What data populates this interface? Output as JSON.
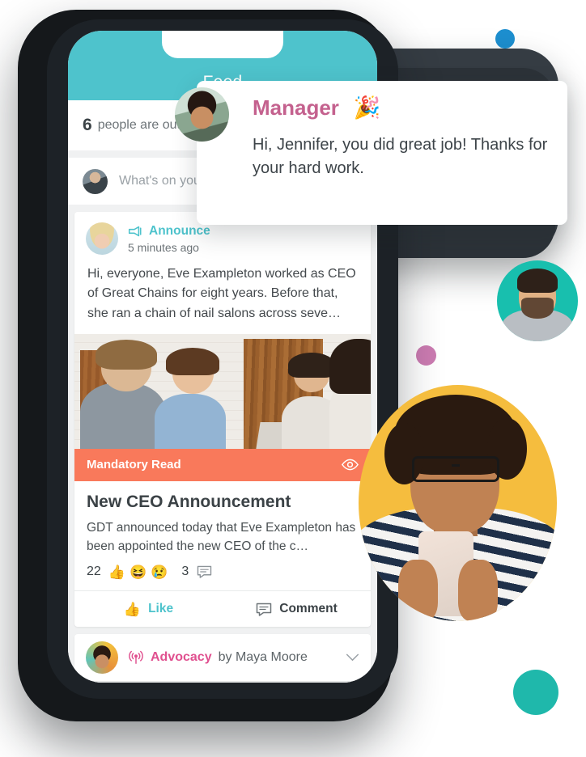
{
  "app": {
    "header": {
      "title": "Feed"
    }
  },
  "out_of_office": {
    "count": "6",
    "text": "people are out"
  },
  "composer": {
    "placeholder": "What's on your m",
    "avatar_name": "user-avatar"
  },
  "post": {
    "type": "Announce",
    "type_icon": "megaphone-icon",
    "timestamp": "5 minutes ago",
    "body": "Hi, everyone, Eve Exampleton worked as CEO of Great Chains for eight years. Before that, she ran a chain of nail salons across seve…",
    "article": {
      "banner_label": "Mandatory Read",
      "banner_icon": "eye-icon",
      "title": "New CEO Announcement",
      "description": "GDT announced today that Eve Exampleton has been appointed the new CEO of the c…",
      "reaction_count": "22",
      "reactions": [
        "👍",
        "😆",
        "😢"
      ],
      "comment_count": "3",
      "comment_icon": "comment-icon"
    },
    "actions": {
      "like_label": "Like",
      "like_icon": "thumbs-up-icon",
      "comment_label": "Comment",
      "comment_icon": "comment-icon"
    }
  },
  "advocacy": {
    "type": "Advocacy",
    "type_icon": "broadcast-icon",
    "by": "by Maya Moore",
    "chevron_icon": "chevron-down-icon"
  },
  "notification": {
    "sender": "Manager",
    "emoji": "🎉",
    "message": "Hi, Jennifer, you did great job! Thanks for your hard work.",
    "avatar_name": "manager-avatar"
  },
  "decor": {
    "blue_dot": "#1d8fd0",
    "pink_dot": "#cb7bb1",
    "teal_dot": "#1fb8ab",
    "yellow_circle": "#f5bd3e",
    "teal_circle": "#18bfae"
  },
  "colors": {
    "header_teal": "#4ec3cc",
    "banner_coral": "#f9795b",
    "advocacy_pink": "#e0508f",
    "manager_pink": "#c4618e"
  }
}
